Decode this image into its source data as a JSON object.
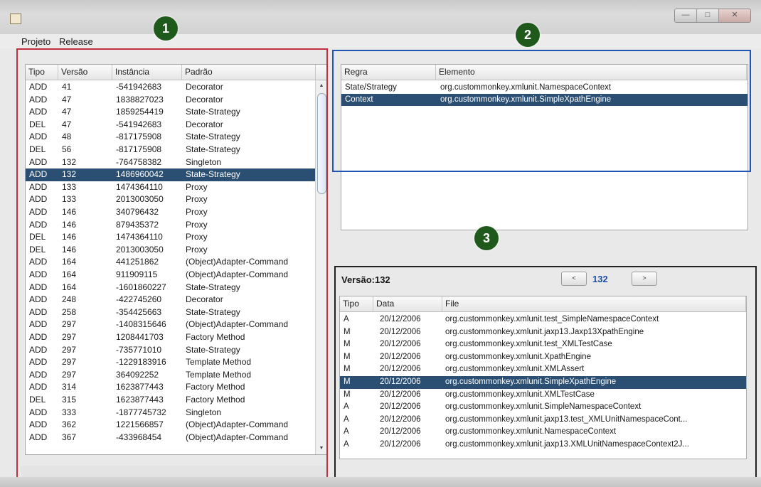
{
  "menu": {
    "items": [
      "Projeto",
      "Release"
    ]
  },
  "badges": [
    "1",
    "2",
    "3"
  ],
  "colors": {
    "selection": "#2b4f73",
    "badge": "#1f5a1c",
    "box1": "#c2303f",
    "box2": "#1f55b5",
    "box3": "#222222"
  },
  "patterns_table": {
    "headers": [
      "Tipo",
      "Versão",
      "Instância",
      "Padrão"
    ],
    "selected_row": 7,
    "rows": [
      [
        "ADD",
        "41",
        "-541942683",
        "Decorator"
      ],
      [
        "ADD",
        "47",
        "1838827023",
        "Decorator"
      ],
      [
        "ADD",
        "47",
        "1859254419",
        "State-Strategy"
      ],
      [
        "DEL",
        "47",
        "-541942683",
        "Decorator"
      ],
      [
        "ADD",
        "48",
        "-817175908",
        "State-Strategy"
      ],
      [
        "DEL",
        "56",
        "-817175908",
        "State-Strategy"
      ],
      [
        "ADD",
        "132",
        "-764758382",
        "Singleton"
      ],
      [
        "ADD",
        "132",
        "1486960042",
        "State-Strategy"
      ],
      [
        "ADD",
        "133",
        "1474364110",
        "Proxy"
      ],
      [
        "ADD",
        "133",
        "2013003050",
        "Proxy"
      ],
      [
        "ADD",
        "146",
        "340796432",
        "Proxy"
      ],
      [
        "ADD",
        "146",
        "879435372",
        "Proxy"
      ],
      [
        "DEL",
        "146",
        "1474364110",
        "Proxy"
      ],
      [
        "DEL",
        "146",
        "2013003050",
        "Proxy"
      ],
      [
        "ADD",
        "164",
        "441251862",
        "(Object)Adapter-Command"
      ],
      [
        "ADD",
        "164",
        "911909115",
        "(Object)Adapter-Command"
      ],
      [
        "ADD",
        "164",
        "-1601860227",
        "State-Strategy"
      ],
      [
        "ADD",
        "248",
        "-422745260",
        "Decorator"
      ],
      [
        "ADD",
        "258",
        "-354425663",
        "State-Strategy"
      ],
      [
        "ADD",
        "297",
        "-1408315646",
        "(Object)Adapter-Command"
      ],
      [
        "ADD",
        "297",
        "1208441703",
        "Factory Method"
      ],
      [
        "ADD",
        "297",
        "-735771010",
        "State-Strategy"
      ],
      [
        "ADD",
        "297",
        "-1229183916",
        "Template Method"
      ],
      [
        "ADD",
        "297",
        "364092252",
        "Template Method"
      ],
      [
        "ADD",
        "314",
        "1623877443",
        "Factory Method"
      ],
      [
        "DEL",
        "315",
        "1623877443",
        "Factory Method"
      ],
      [
        "ADD",
        "333",
        "-1877745732",
        "Singleton"
      ],
      [
        "ADD",
        "362",
        "1221566857",
        "(Object)Adapter-Command"
      ],
      [
        "ADD",
        "367",
        "-433968454",
        "(Object)Adapter-Command"
      ]
    ]
  },
  "rules_table": {
    "headers": [
      "Regra",
      "Elemento"
    ],
    "selected_row": 1,
    "rows": [
      [
        "State/Strategy",
        "org.custommonkey.xmlunit.NamespaceContext"
      ],
      [
        "Context",
        "org.custommonkey.xmlunit.SimpleXpathEngine"
      ]
    ]
  },
  "version_panel": {
    "label": "Versão:132",
    "prev_label": "<",
    "next_label": ">",
    "current": "132"
  },
  "files_table": {
    "headers": [
      "Tipo",
      "Data",
      "File"
    ],
    "selected_row": 5,
    "rows": [
      [
        "A",
        "20/12/2006",
        "org.custommonkey.xmlunit.test_SimpleNamespaceContext"
      ],
      [
        "M",
        "20/12/2006",
        "org.custommonkey.xmlunit.jaxp13.Jaxp13XpathEngine"
      ],
      [
        "M",
        "20/12/2006",
        "org.custommonkey.xmlunit.test_XMLTestCase"
      ],
      [
        "M",
        "20/12/2006",
        "org.custommonkey.xmlunit.XpathEngine"
      ],
      [
        "M",
        "20/12/2006",
        "org.custommonkey.xmlunit.XMLAssert"
      ],
      [
        "M",
        "20/12/2006",
        "org.custommonkey.xmlunit.SimpleXpathEngine"
      ],
      [
        "M",
        "20/12/2006",
        "org.custommonkey.xmlunit.XMLTestCase"
      ],
      [
        "A",
        "20/12/2006",
        "org.custommonkey.xmlunit.SimpleNamespaceContext"
      ],
      [
        "A",
        "20/12/2006",
        "org.custommonkey.xmlunit.jaxp13.test_XMLUnitNamespaceCont..."
      ],
      [
        "A",
        "20/12/2006",
        "org.custommonkey.xmlunit.NamespaceContext"
      ],
      [
        "A",
        "20/12/2006",
        "org.custommonkey.xmlunit.jaxp13.XMLUnitNamespaceContext2J..."
      ]
    ]
  }
}
